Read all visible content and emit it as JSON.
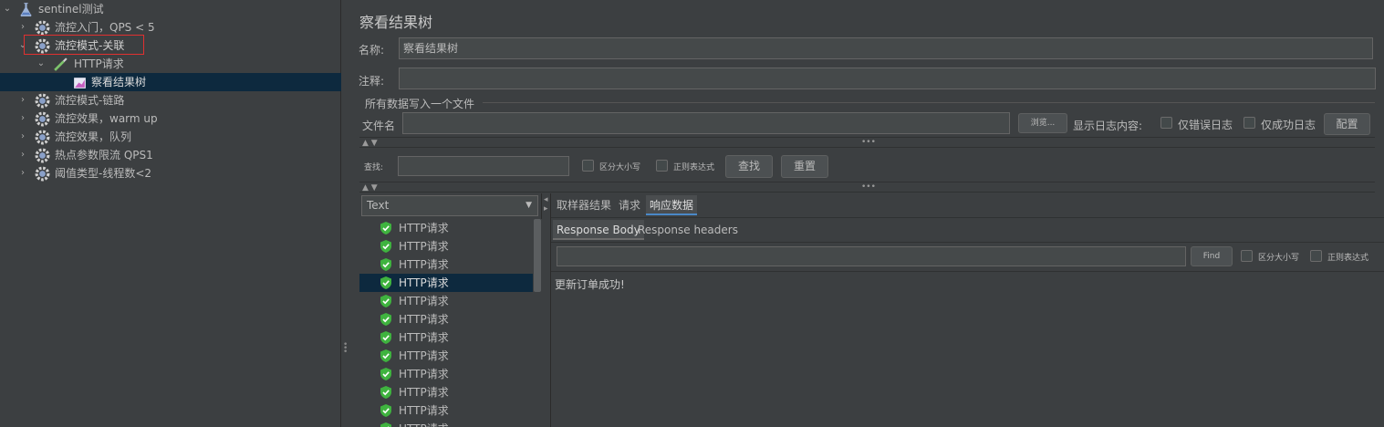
{
  "tree": {
    "root": "sentinel测试",
    "items": [
      {
        "label": "流控入门，QPS < 5"
      },
      {
        "label": "流控模式-关联"
      },
      {
        "label": "HTTP请求"
      },
      {
        "label": "察看结果树"
      },
      {
        "label": "流控模式-链路"
      },
      {
        "label": "流控效果，warm up"
      },
      {
        "label": "流控效果，队列"
      },
      {
        "label": "热点参数限流 QPS1"
      },
      {
        "label": "阈值类型-线程数<2"
      }
    ]
  },
  "panel": {
    "title": "察看结果树",
    "name_label": "名称:",
    "name_value": "察看结果树",
    "comment_label": "注释:",
    "comment_value": "",
    "file_section": "所有数据写入一个文件",
    "filename_label": "文件名",
    "filename_value": "",
    "browse_button": "浏览...",
    "log_content_label": "显示日志内容:",
    "errors_only": "仅错误日志",
    "success_only": "仅成功日志",
    "configure_button": "配置"
  },
  "search": {
    "label": "查找:",
    "value": "",
    "case_sensitive": "区分大小写",
    "regex": "正则表达式",
    "find_button": "查找",
    "reset_button": "重置"
  },
  "results": {
    "renderer": "Text",
    "items": [
      "HTTP请求",
      "HTTP请求",
      "HTTP请求",
      "HTTP请求",
      "HTTP请求",
      "HTTP请求",
      "HTTP请求",
      "HTTP请求",
      "HTTP请求",
      "HTTP请求",
      "HTTP请求",
      "HTTP请求"
    ],
    "selected_index": 3
  },
  "detail": {
    "tabs": [
      "取样器结果",
      "请求",
      "响应数据"
    ],
    "active_tab": "响应数据",
    "subtabs": [
      "Response Body",
      "Response headers"
    ],
    "active_subtab": "Response Body",
    "find_button": "Find",
    "case_sensitive": "区分大小写",
    "regex": "正则表达式",
    "body": "更新订单成功!"
  },
  "colors": {
    "background": "#3c3f41",
    "selection": "#0d293e",
    "highlight_box": "#e03030",
    "shield_green": "#3fb33f"
  }
}
